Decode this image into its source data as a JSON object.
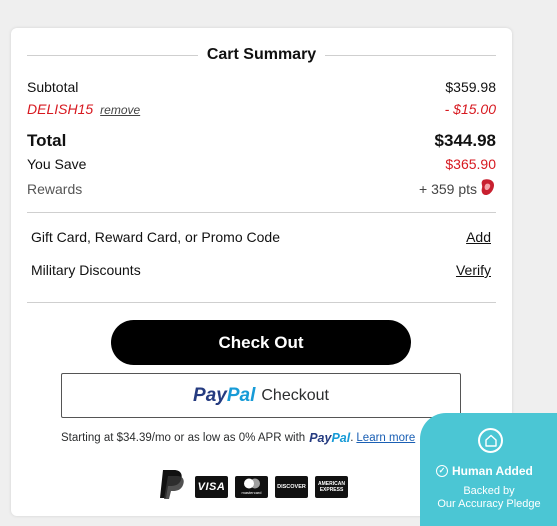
{
  "summary": {
    "title": "Cart Summary",
    "subtotal_label": "Subtotal",
    "subtotal_value": "$359.98",
    "promo_code": "DELISH15",
    "remove_label": "remove",
    "discount_value": "- $15.00",
    "total_label": "Total",
    "total_value": "$344.98",
    "save_label": "You Save",
    "save_value": "$365.90",
    "rewards_label": "Rewards",
    "rewards_value": "+ 359 pts"
  },
  "actions": {
    "giftcard_label": "Gift Card, Reward Card, or Promo Code",
    "giftcard_link": "Add",
    "military_label": "Military Discounts",
    "military_link": "Verify"
  },
  "checkout": {
    "button_label": "Check Out",
    "paypal_pay": "Pay",
    "paypal_pal": "Pal",
    "paypal_checkout": "Checkout"
  },
  "financing": {
    "text": "Starting at $34.39/mo or as low as 0% APR with",
    "paypal_pay": "Pay",
    "paypal_pal": "Pal",
    "after": ".",
    "learn_more": "Learn more"
  },
  "payment_icons": {
    "paypal": "paypal-icon",
    "visa_text": "VISA",
    "mastercard_text": "mastercard",
    "discover_text": "DISCOVER",
    "amex_text": "AMERICAN EXPRESS"
  },
  "badge": {
    "title": "Human Added",
    "line1": "Backed by",
    "line2": "Our Accuracy Pledge"
  },
  "colors": {
    "accent_red": "#d71920",
    "badge_teal": "#4bc6d4",
    "paypal_dark": "#253b80",
    "paypal_light": "#179bd7"
  }
}
